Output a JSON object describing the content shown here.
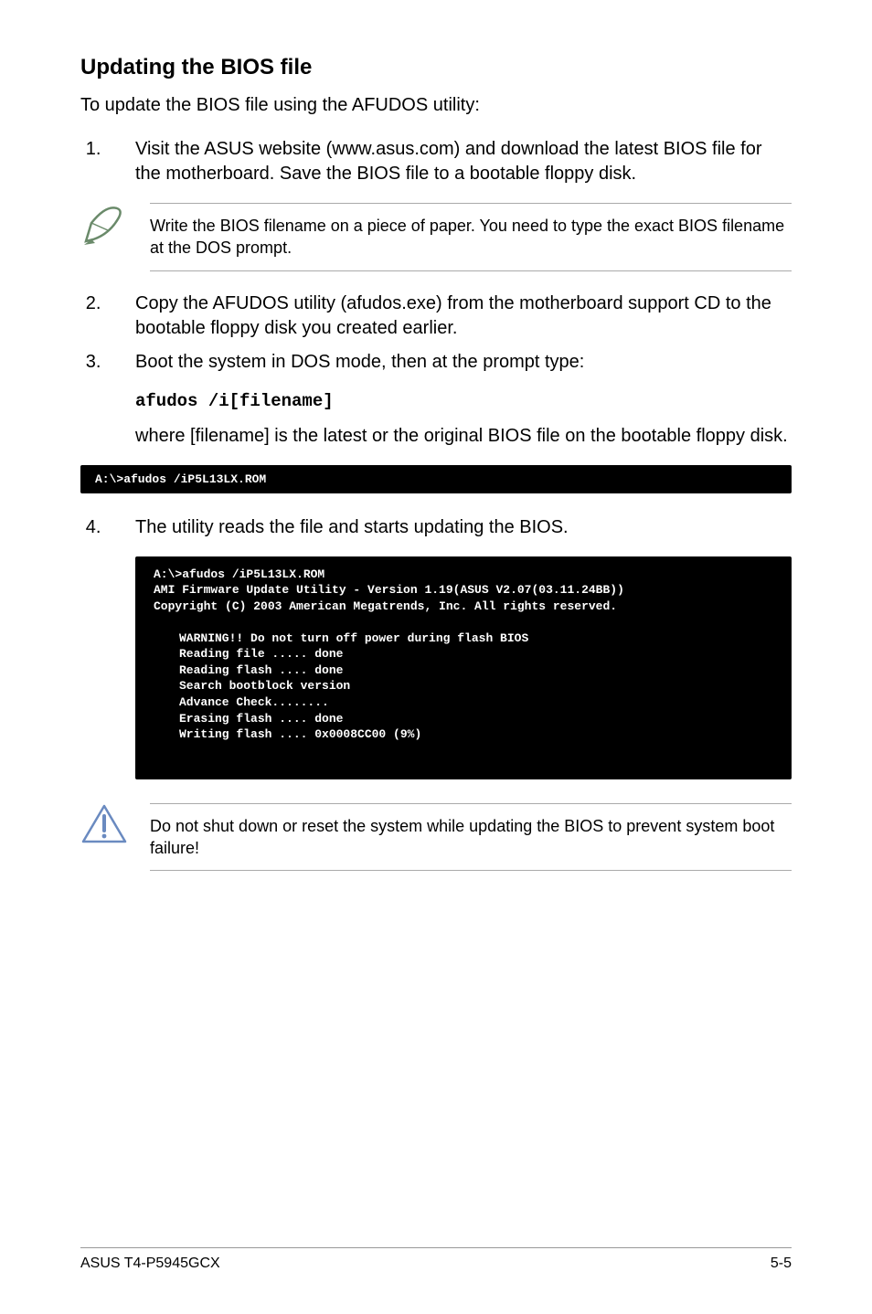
{
  "headings": {
    "updating": "Updating the BIOS file"
  },
  "paras": {
    "intro": "To update the BIOS file using the AFUDOS utility:",
    "where": "where [filename] is the latest or the original BIOS file on the bootable floppy disk."
  },
  "steps": {
    "s1": "Visit the ASUS website (www.asus.com) and download the latest BIOS file for the motherboard. Save the BIOS file to a bootable floppy disk.",
    "s2": "Copy the AFUDOS utility (afudos.exe) from the motherboard support CD to the bootable floppy disk you created earlier.",
    "s3": "Boot the system in DOS mode, then at the prompt type:",
    "s4": "The utility reads the file and starts updating the BIOS."
  },
  "notes": {
    "write_name": "Write the BIOS filename on a piece of paper. You need to type the exact BIOS filename at the DOS prompt.",
    "caution": "Do not shut down or reset the system while updating the BIOS to prevent system boot failure!"
  },
  "code": {
    "afudos_cmd": "afudos /i[filename]"
  },
  "terminal": {
    "line1": "A:\\>afudos /iP5L13LX.ROM",
    "blk2_l1": "A:\\>afudos /iP5L13LX.ROM",
    "blk2_l2": "AMI Firmware Update Utility - Version 1.19(ASUS V2.07(03.11.24BB))",
    "blk2_l3": "Copyright (C) 2003 American Megatrends, Inc. All rights reserved.",
    "blk2_i1": "WARNING!! Do not turn off power during flash BIOS",
    "blk2_i2": "Reading file ..... done",
    "blk2_i3": "Reading flash .... done",
    "blk2_i4": "Search bootblock version",
    "blk2_i5": "Advance Check........",
    "blk2_i6": "Erasing flash .... done",
    "blk2_i7": "Writing flash .... 0x0008CC00 (9%)"
  },
  "footer": {
    "left": "ASUS T4-P5945GCX",
    "right": "5-5"
  }
}
